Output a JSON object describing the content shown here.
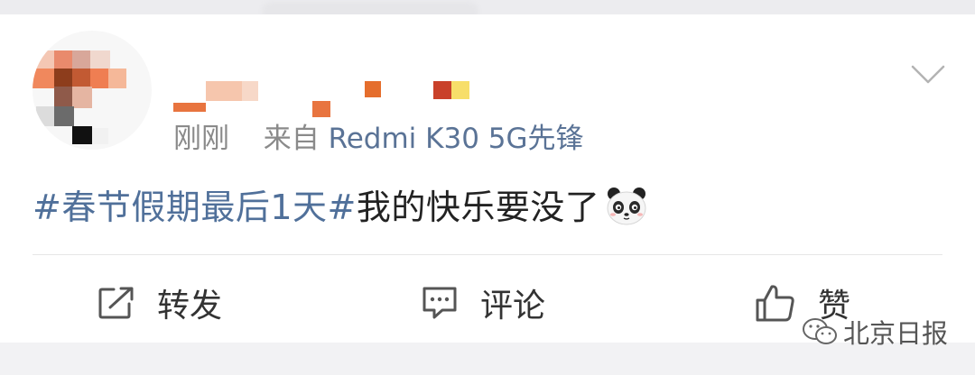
{
  "post": {
    "meta": {
      "time": "刚刚",
      "from_prefix": "来自",
      "source": "Redmi K30 5G先锋"
    },
    "topic": "#春节假期最后1天#",
    "text": "我的快乐要没了",
    "emoji_icon": "panda-emoji-icon"
  },
  "actions": {
    "repost_label": "转发",
    "comment_label": "评论",
    "like_label": "赞"
  },
  "watermark": {
    "label": "北京日报"
  },
  "colors": {
    "topic": "#50709a",
    "source": "#5a7396",
    "meta": "#8a8a8a",
    "text": "#222222",
    "card": "#ffffff",
    "page_bg": "#f2f2f4"
  }
}
